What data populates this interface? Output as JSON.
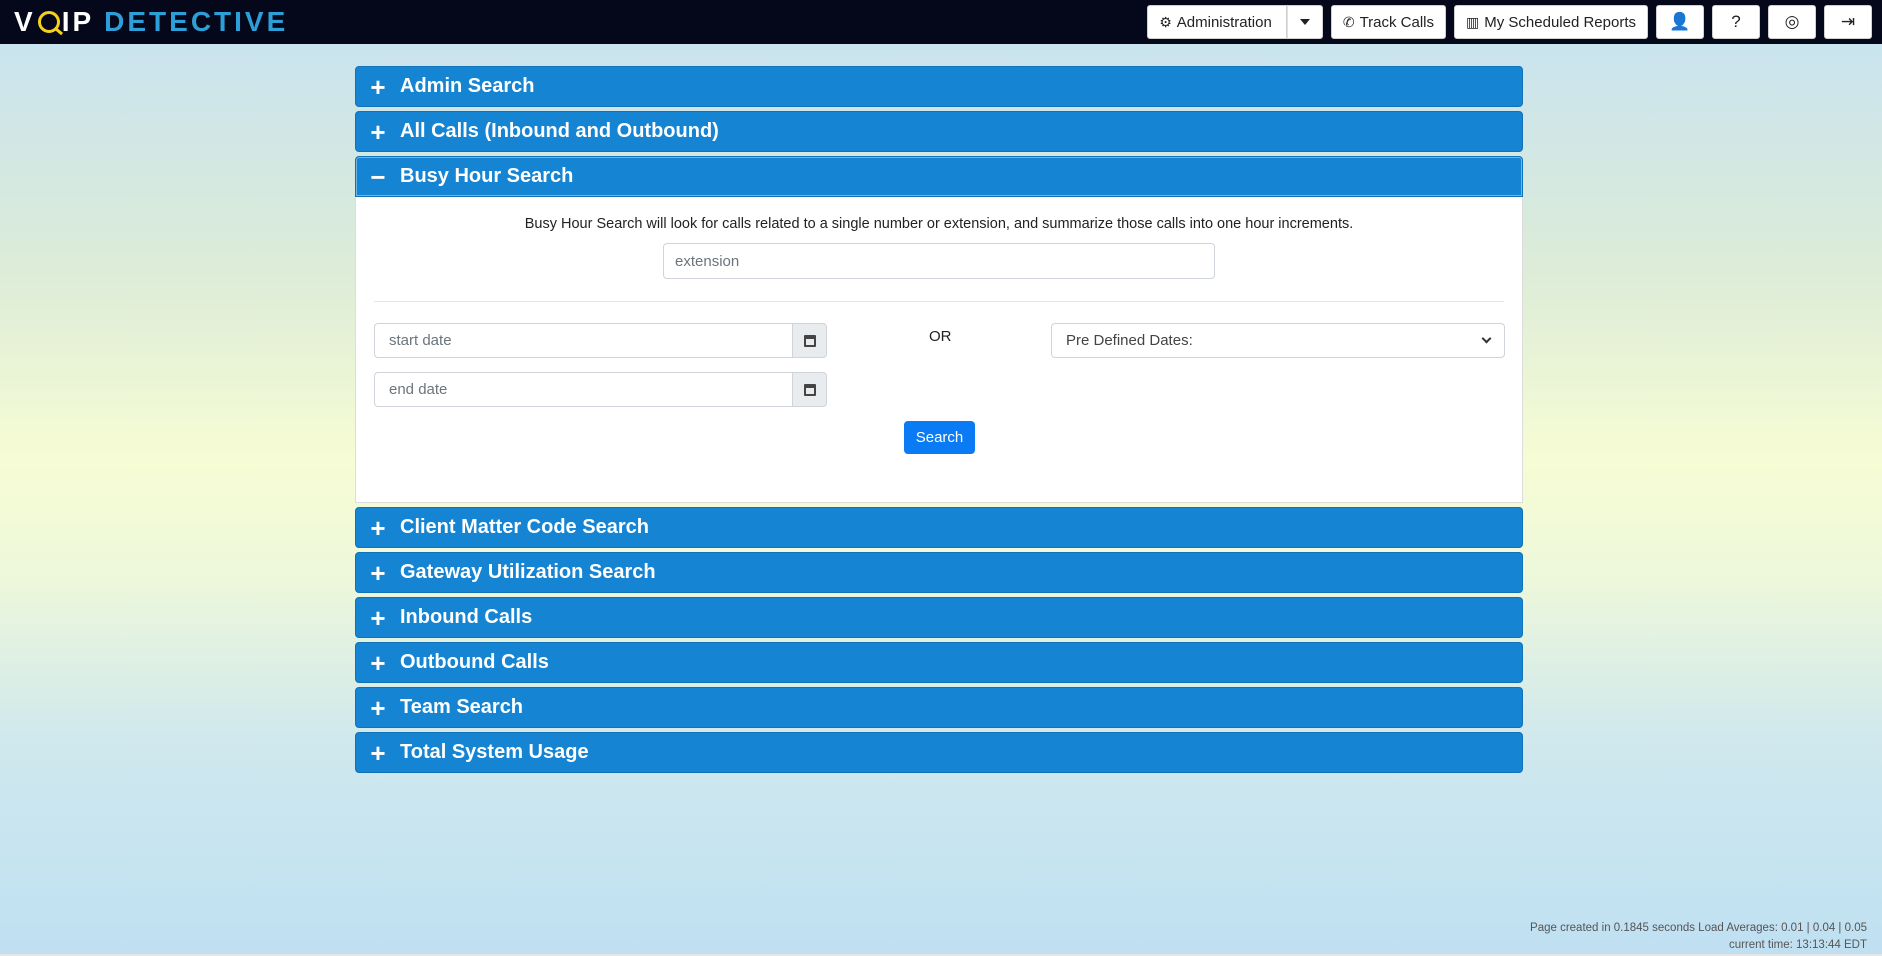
{
  "brand": {
    "voip_v": "V",
    "voip_rest": "IP",
    "detective": "DETECTIVE"
  },
  "nav": {
    "administration": "Administration",
    "track_calls": "Track Calls",
    "scheduled_reports": "My Scheduled Reports"
  },
  "panels": [
    {
      "title": "Admin Search",
      "icon": "+"
    },
    {
      "title": "All Calls (Inbound and Outbound)",
      "icon": "+"
    },
    {
      "title": "Busy Hour Search",
      "icon": "−"
    },
    {
      "title": "Client Matter Code Search",
      "icon": "+"
    },
    {
      "title": "Gateway Utilization Search",
      "icon": "+"
    },
    {
      "title": "Inbound Calls",
      "icon": "+"
    },
    {
      "title": "Outbound Calls",
      "icon": "+"
    },
    {
      "title": "Team Search",
      "icon": "+"
    },
    {
      "title": "Total System Usage",
      "icon": "+"
    }
  ],
  "busy_hour": {
    "description": "Busy Hour Search will look for calls related to a single number or extension, and summarize those calls into one hour increments.",
    "extension_placeholder": "extension",
    "start_placeholder": "start date",
    "end_placeholder": "end date",
    "or_label": "OR",
    "predefined_selected": "Pre Defined Dates:",
    "search_label": "Search"
  },
  "footer": {
    "page_created": "Page created in 0.1845 seconds Load Averages: 0.01 | 0.04 | 0.05",
    "current_time": "current time: 13:13:44 EDT"
  },
  "colors": {
    "topbar": "#05081a",
    "panel_header": "#1584d3",
    "search_button": "#0a7bf5",
    "brand_accent": "#2c9fd8",
    "logo_o": "#f4d21a"
  }
}
